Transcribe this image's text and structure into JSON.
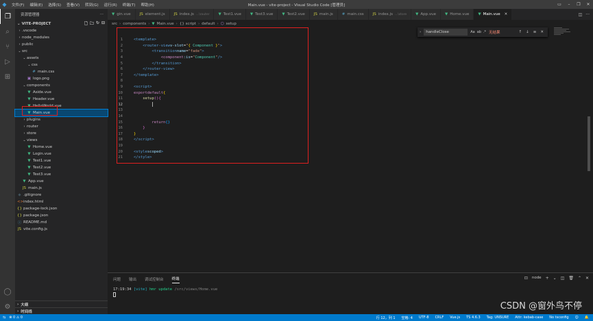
{
  "window": {
    "title": "Main.vue - vite-project - Visual Studio Code [管理员]",
    "menu": [
      "文件(F)",
      "编辑(E)",
      "选择(S)",
      "查看(V)",
      "转到(G)",
      "运行(R)",
      "终端(T)",
      "帮助(H)"
    ]
  },
  "sidebar": {
    "header": "资源管理器",
    "project": "VITE-PROJECT",
    "tree": [
      {
        "label": ".vscode",
        "icon": "chevron-right",
        "type": "folder"
      },
      {
        "label": "node_modules",
        "icon": "chevron-right",
        "type": "folder"
      },
      {
        "label": "public",
        "icon": "chevron-right",
        "type": "folder"
      },
      {
        "label": "src",
        "icon": "chevron-down",
        "type": "folder"
      },
      {
        "label": "assets",
        "icon": "chevron-down",
        "type": "folder"
      },
      {
        "label": "css",
        "icon": "chevron-down",
        "type": "folder"
      },
      {
        "label": "main.css",
        "icon": "#",
        "type": "css"
      },
      {
        "label": "logo.png",
        "icon": "▣",
        "type": "img"
      },
      {
        "label": "components",
        "icon": "chevron-down",
        "type": "folder"
      },
      {
        "label": "Aside.vue",
        "icon": "▼",
        "type": "vue"
      },
      {
        "label": "Header.vue",
        "icon": "▼",
        "type": "vue"
      },
      {
        "label": "HelloWorld.vue",
        "icon": "▼",
        "type": "vue"
      },
      {
        "label": "Main.vue",
        "icon": "▼",
        "type": "vue"
      },
      {
        "label": "plugins",
        "icon": "chevron-right",
        "type": "folder"
      },
      {
        "label": "router",
        "icon": "chevron-right",
        "type": "folder"
      },
      {
        "label": "store",
        "icon": "chevron-right",
        "type": "folder"
      },
      {
        "label": "views",
        "icon": "chevron-down",
        "type": "folder"
      },
      {
        "label": "Home.vue",
        "icon": "▼",
        "type": "vue"
      },
      {
        "label": "Login.vue",
        "icon": "▼",
        "type": "vue"
      },
      {
        "label": "Test1.vue",
        "icon": "▼",
        "type": "vue"
      },
      {
        "label": "Test2.vue",
        "icon": "▼",
        "type": "vue"
      },
      {
        "label": "Test3.vue",
        "icon": "▼",
        "type": "vue"
      },
      {
        "label": "App.vue",
        "icon": "▼",
        "type": "vue"
      },
      {
        "label": "main.js",
        "icon": "JS",
        "type": "js"
      },
      {
        "label": ".gitignore",
        "icon": "◆",
        "type": "git"
      },
      {
        "label": "index.html",
        "icon": "<>",
        "type": "html"
      },
      {
        "label": "package-lock.json",
        "icon": "{}",
        "type": "json"
      },
      {
        "label": "package.json",
        "icon": "{}",
        "type": "json"
      },
      {
        "label": "README.md",
        "icon": "ⓘ",
        "type": "md"
      },
      {
        "label": "vite.config.js",
        "icon": "JS",
        "type": "js"
      }
    ],
    "outline_label": "大纲",
    "timeline_label": "时间线"
  },
  "tabs": [
    {
      "label": "gin.vue",
      "hint": ""
    },
    {
      "label": "element.js",
      "hint": ""
    },
    {
      "label": "index.js",
      "hint": "...\\router"
    },
    {
      "label": "Test1.vue",
      "hint": ""
    },
    {
      "label": "Test3.vue",
      "hint": ""
    },
    {
      "label": "Test2.vue",
      "hint": ""
    },
    {
      "label": "main.js",
      "hint": ""
    },
    {
      "label": "main.css",
      "hint": ""
    },
    {
      "label": "index.js",
      "hint": "...\\store"
    },
    {
      "label": "App.vue",
      "hint": ""
    },
    {
      "label": "Home.vue",
      "hint": ""
    },
    {
      "label": "Main.vue",
      "hint": ""
    }
  ],
  "breadcrumb": [
    "src",
    "components",
    "Main.vue",
    "{} script",
    "default",
    "setup"
  ],
  "find": {
    "value": "handleClose",
    "options": [
      "Aa",
      "ab",
      ".*"
    ],
    "result": "无结果"
  },
  "code_lines": [
    "1",
    "2",
    "3",
    "4",
    "5",
    "6",
    "7",
    "8",
    "9",
    "10",
    "11",
    "12",
    "13",
    "14",
    "15",
    "16",
    "17",
    "18",
    "19",
    "20"
  ],
  "panel": {
    "tabs": [
      "问题",
      "输出",
      "调试控制台",
      "终端"
    ],
    "terminal_name": "node",
    "log_time": "17:19:34",
    "log_tag": "[vite]",
    "log_msg": "hmr update",
    "log_path": "/src/views/Home.vue"
  },
  "watermark": "CSDN @窗外鸟不停",
  "status": {
    "errors": "⊗ 0 ⚠ 0",
    "position": "行 12，列 1",
    "spaces": "空格: 4",
    "encoding": "UTF-8",
    "eol": "CRLF",
    "language": "Vue.js",
    "ts_version": "TS 4.6.3",
    "tag_case": "Tag: UNSURE",
    "attr_case": "Attr: kebab-case",
    "tsconfig": "No tsconfig"
  },
  "colors": {
    "accent": "#007acc",
    "highlight_box": "#e02020",
    "vue_icon": "#41b883"
  }
}
